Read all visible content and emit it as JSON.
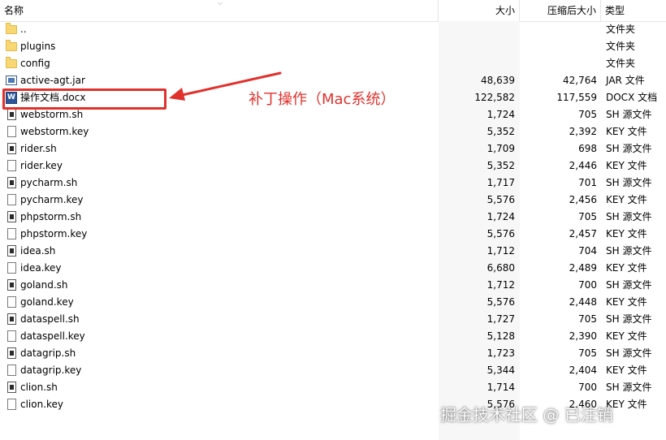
{
  "header": {
    "name": "名称",
    "size": "大小",
    "compressed_size": "压缩后大小",
    "type": "类型"
  },
  "files": [
    {
      "name": "..",
      "size": "",
      "compressed_size": "",
      "type": "文件夹",
      "icon": "folder-icon"
    },
    {
      "name": "plugins",
      "size": "",
      "compressed_size": "",
      "type": "文件夹",
      "icon": "folder-icon"
    },
    {
      "name": "config",
      "size": "",
      "compressed_size": "",
      "type": "文件夹",
      "icon": "folder-icon"
    },
    {
      "name": "active-agt.jar",
      "size": "48,639",
      "compressed_size": "42,764",
      "type": "JAR 文件",
      "icon": "jar-file-icon"
    },
    {
      "name": "操作文档.docx",
      "size": "122,582",
      "compressed_size": "117,559",
      "type": "DOCX 文档",
      "icon": "docx-file-icon",
      "icon_label": "W"
    },
    {
      "name": "webstorm.sh",
      "size": "1,724",
      "compressed_size": "705",
      "type": "SH 源文件",
      "icon": "sh-file-icon"
    },
    {
      "name": "webstorm.key",
      "size": "5,352",
      "compressed_size": "2,392",
      "type": "KEY 文件",
      "icon": "key-file-icon"
    },
    {
      "name": "rider.sh",
      "size": "1,709",
      "compressed_size": "698",
      "type": "SH 源文件",
      "icon": "sh-file-icon"
    },
    {
      "name": "rider.key",
      "size": "5,352",
      "compressed_size": "2,446",
      "type": "KEY 文件",
      "icon": "key-file-icon"
    },
    {
      "name": "pycharm.sh",
      "size": "1,717",
      "compressed_size": "701",
      "type": "SH 源文件",
      "icon": "sh-file-icon"
    },
    {
      "name": "pycharm.key",
      "size": "5,576",
      "compressed_size": "2,456",
      "type": "KEY 文件",
      "icon": "key-file-icon"
    },
    {
      "name": "phpstorm.sh",
      "size": "1,724",
      "compressed_size": "705",
      "type": "SH 源文件",
      "icon": "sh-file-icon"
    },
    {
      "name": "phpstorm.key",
      "size": "5,576",
      "compressed_size": "2,457",
      "type": "KEY 文件",
      "icon": "key-file-icon"
    },
    {
      "name": "idea.sh",
      "size": "1,712",
      "compressed_size": "704",
      "type": "SH 源文件",
      "icon": "sh-file-icon"
    },
    {
      "name": "idea.key",
      "size": "6,680",
      "compressed_size": "2,489",
      "type": "KEY 文件",
      "icon": "key-file-icon"
    },
    {
      "name": "goland.sh",
      "size": "1,712",
      "compressed_size": "700",
      "type": "SH 源文件",
      "icon": "sh-file-icon"
    },
    {
      "name": "goland.key",
      "size": "5,576",
      "compressed_size": "2,448",
      "type": "KEY 文件",
      "icon": "key-file-icon"
    },
    {
      "name": "dataspell.sh",
      "size": "1,727",
      "compressed_size": "705",
      "type": "SH 源文件",
      "icon": "sh-file-icon"
    },
    {
      "name": "dataspell.key",
      "size": "5,128",
      "compressed_size": "2,390",
      "type": "KEY 文件",
      "icon": "key-file-icon"
    },
    {
      "name": "datagrip.sh",
      "size": "1,723",
      "compressed_size": "705",
      "type": "SH 源文件",
      "icon": "sh-file-icon"
    },
    {
      "name": "datagrip.key",
      "size": "5,344",
      "compressed_size": "2,404",
      "type": "KEY 文件",
      "icon": "key-file-icon"
    },
    {
      "name": "clion.sh",
      "size": "1,714",
      "compressed_size": "700",
      "type": "SH 源文件",
      "icon": "sh-file-icon"
    },
    {
      "name": "clion.key",
      "size": "5,576",
      "compressed_size": "2,460",
      "type": "KEY 文件",
      "icon": "key-file-icon"
    }
  ],
  "annotation": {
    "text": "补丁操作（Mac系统）",
    "color": "#e0312c"
  },
  "watermark": "掘金技术社区 @ 已注销",
  "colors": {
    "size_column_bg": "#f7f7f7",
    "highlight": "#e0312c"
  }
}
